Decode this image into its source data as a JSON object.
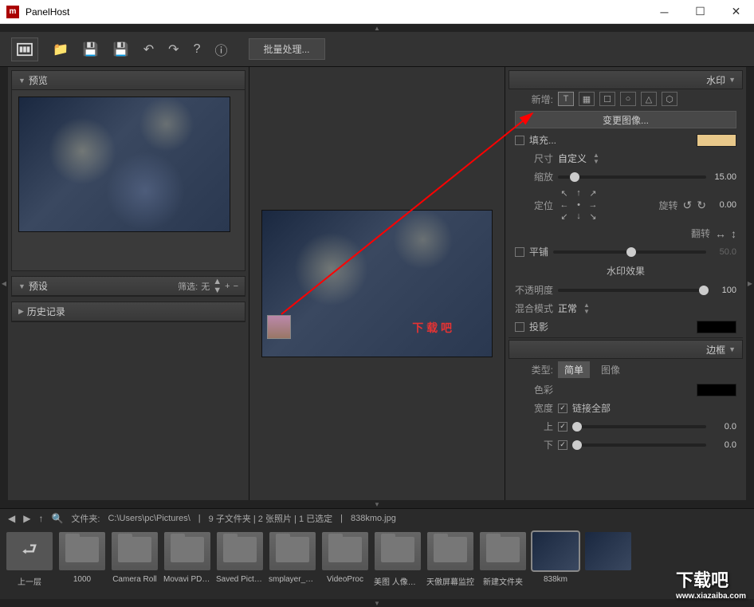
{
  "window": {
    "title": "PanelHost"
  },
  "toolbar": {
    "batch": "批量处理..."
  },
  "left": {
    "preview": "预览",
    "presets": "预设",
    "filter_label": "筛选:",
    "filter_value": "无",
    "history": "历史记录"
  },
  "canvas": {
    "wm_text": "下 载 吧"
  },
  "right": {
    "watermark_title": "水印",
    "add_label": "新增:",
    "text_sym": "T",
    "change_image": "变更图像...",
    "fill": "填充...",
    "size_label": "尺寸",
    "size_value": "自定义",
    "scale_label": "缩放",
    "scale_value": "15.00",
    "position_label": "定位",
    "rotate_label": "旋转",
    "rotate_value": "0.00",
    "flip_label": "翻转",
    "tile_label": "平铺",
    "tile_value": "50.0",
    "effects_title": "水印效果",
    "opacity_label": "不透明度",
    "opacity_value": "100",
    "blend_label": "混合模式",
    "blend_value": "正常",
    "shadow_label": "投影",
    "border_title": "边框",
    "type_label": "类型:",
    "type_simple": "简单",
    "type_image": "图像",
    "color_label": "色彩",
    "width_label": "宽度",
    "link_all": "链接全部",
    "top_label": "上",
    "bottom_label": "下",
    "side_value": "0.0"
  },
  "status": {
    "folder_label": "文件夹:",
    "path": "C:\\Users\\pc\\Pictures\\",
    "info": "9 子文件夹 | 2 张照片 | 1 已选定",
    "filename": "838kmo.jpg"
  },
  "filmstrip": [
    {
      "label": "上一层",
      "type": "up"
    },
    {
      "label": "1000",
      "type": "folder"
    },
    {
      "label": "Camera Roll",
      "type": "folder"
    },
    {
      "label": "Movavi PDF E...",
      "type": "folder"
    },
    {
      "label": "Saved Pictures",
      "type": "folder"
    },
    {
      "label": "smplayer_scre...",
      "type": "folder"
    },
    {
      "label": "VideoProc",
      "type": "folder"
    },
    {
      "label": "美图 人像写真",
      "type": "folder"
    },
    {
      "label": "天傲屏幕监控",
      "type": "folder"
    },
    {
      "label": "新建文件夹",
      "type": "folder"
    },
    {
      "label": "838km",
      "type": "img",
      "selected": true
    },
    {
      "label": "",
      "type": "img"
    }
  ],
  "overlay": {
    "brand": "下载吧",
    "url": "www.xiazaiba.com"
  }
}
